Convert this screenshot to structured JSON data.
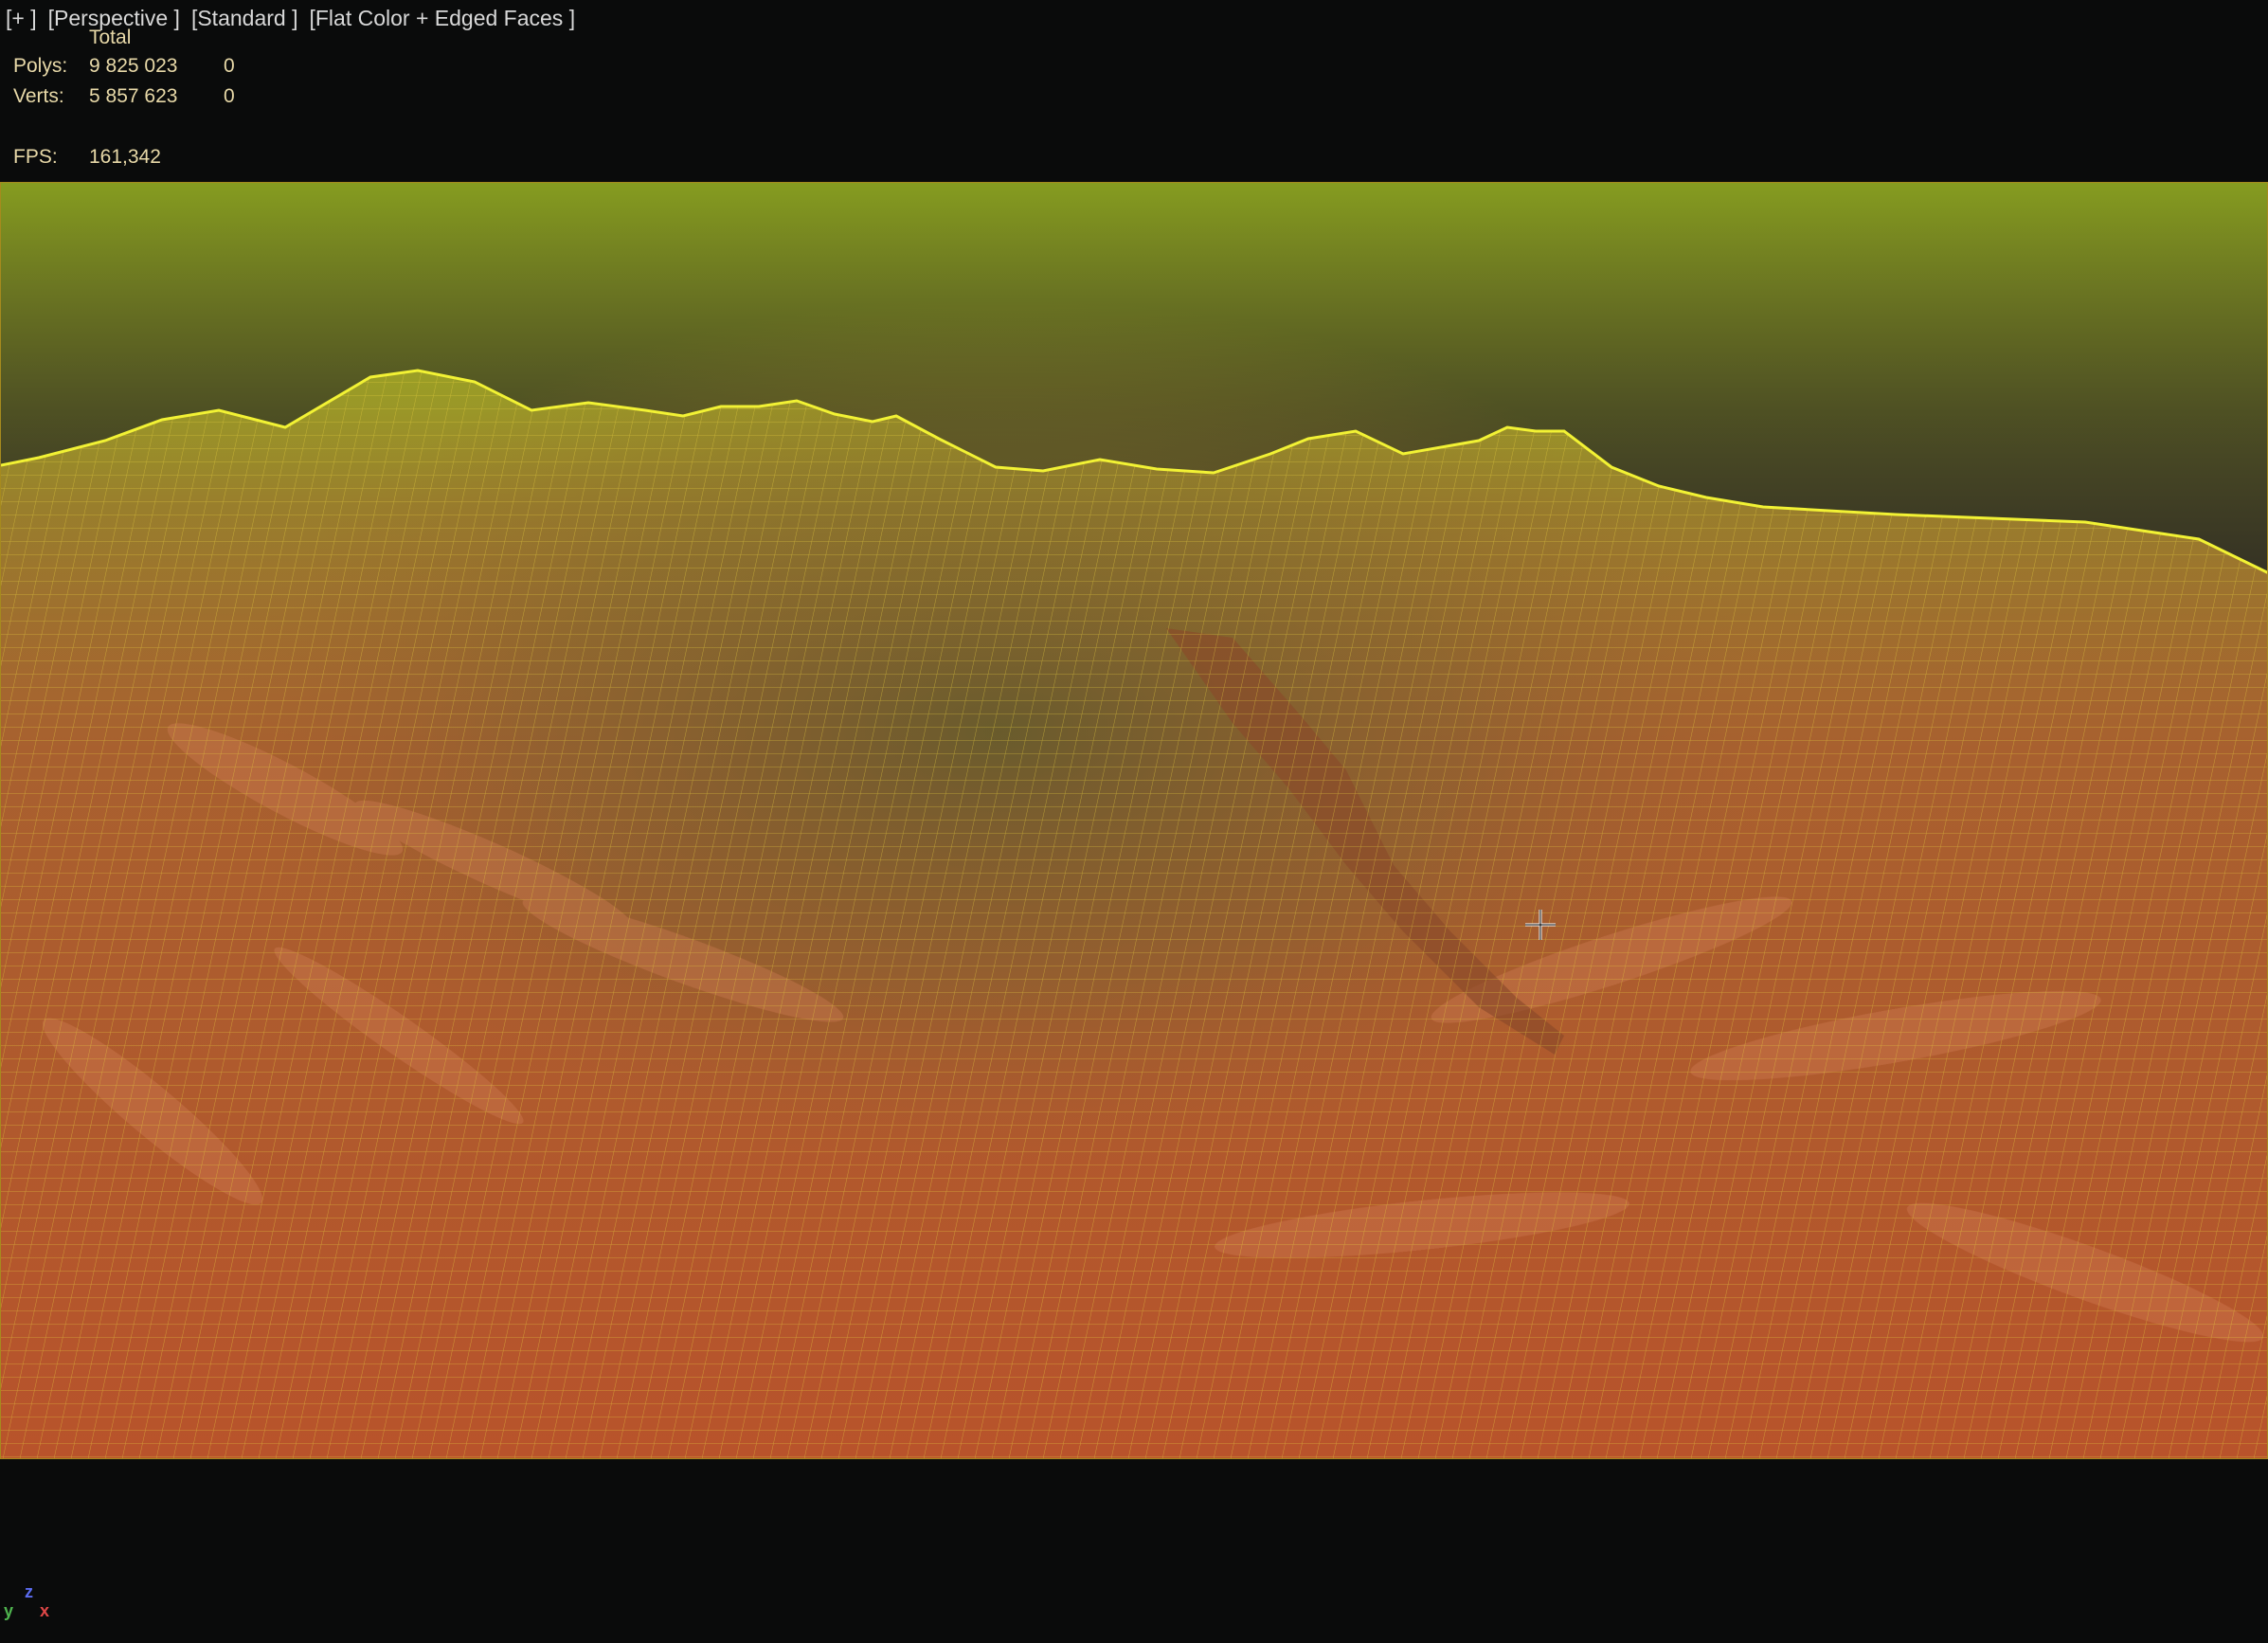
{
  "viewport": {
    "menu": [
      "[+ ]",
      "[Perspective ]",
      "[Standard ]",
      "[Flat Color + Edged Faces ]"
    ]
  },
  "stats": {
    "total_header": "Total",
    "polys_label": "Polys:",
    "polys_total": "9 825 023",
    "polys_selected": "0",
    "verts_label": "Verts:",
    "verts_total": "5 857 623",
    "verts_selected": "0",
    "fps_label": "FPS:",
    "fps_value": "161,342"
  },
  "colors": {
    "background": "#0a0b0b",
    "sky": "#252525",
    "terrain_base": "#b4562d",
    "wireframe": "#e8d238",
    "silhouette": "#f2f234",
    "border": "#a68a1e"
  },
  "axis_gizmo": {
    "z": "z",
    "y": "y",
    "x": "x"
  },
  "icons": {
    "cursor": "crosshair-move-cursor-icon"
  }
}
